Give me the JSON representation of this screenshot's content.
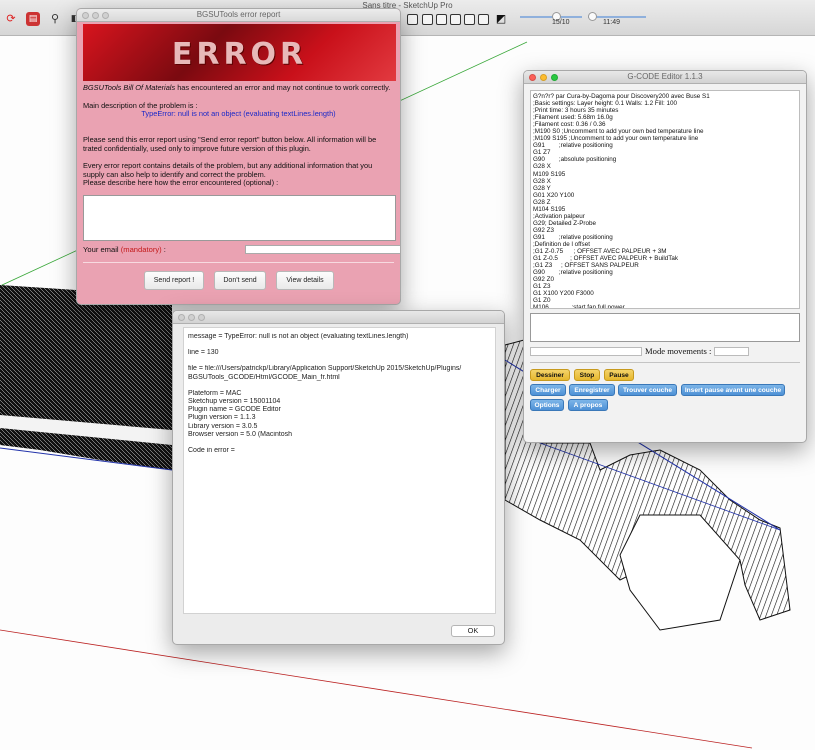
{
  "app": {
    "title": "Sans titre - SketchUp Pro",
    "scene_slider_label": "15/10",
    "time_slider_label": "11:49"
  },
  "toolbar": {
    "icons": [
      "refresh-icon",
      "clipboard-icon",
      "magnifier-icon",
      "plugin-icon",
      "shadow-icon",
      "camera-icon",
      "home-icon",
      "box-icon",
      "box-icon-2",
      "house-icon",
      "lamp-icon"
    ]
  },
  "error_window": {
    "title": "BGSUTools error report",
    "banner_text": "ERROR",
    "plugin_name": "BGSUTools Bill Of Materials",
    "intro_suffix": " has encountered an error and may not continue to work correctly.",
    "main_description_label": "Main description of the problem is :",
    "error_message": "TypeError: null is not an object (evaluating textLines.length)",
    "send_text": "Please send this error report using \"Send error report\" button below. All information will be trated confidentially, used only to improve future version of this plugin.",
    "details_text": "Every error report contains details of the problem, but any additional information that you supply can also help to identify and correct the problem.",
    "describe_label": "Please describe here how the error encountered (optional) :",
    "email_label": "Your email",
    "email_mandatory": "(mandatory)",
    "email_colon": " :",
    "buttons": {
      "send": "Send report !",
      "dont_send": "Don't send",
      "view_details": "View details"
    },
    "colors": {
      "background": "#eaa2b2",
      "error_blue": "#1a28c8",
      "mandatory_red": "#c41a1a"
    }
  },
  "details_window": {
    "message": "message = TypeError: null is not an object (evaluating textLines.length)",
    "line": "line = 130",
    "file_1": "file = file:///Users/patrickp/Library/Application Support/SketchUp 2015/SketchUp/Plugins/",
    "file_2": "BGSUTools_GCODE/Html/GCODE_Main_fr.html",
    "platform": "Plateform = MAC",
    "sketchup_version": "Sketchup version = 15001104",
    "plugin_name": "Plugin name = GCODE Editor",
    "plugin_version": "Plugin version = 1.1.3",
    "library_version": "Library version = 3.0.5",
    "browser_version": "Browser version = 5.0 (Macintosh",
    "code_in_error": "Code in error =",
    "ok_label": "OK"
  },
  "gcode_window": {
    "title": "G-CODE Editor 1.1.3",
    "lines": [
      "G?n?r? par Cura-by-Dagoma pour Discovery200 avec Buse S1",
      ";Basic settings: Layer height: 0.1 Walls: 1.2 Fill: 100",
      ";Print time: 3 hours 35 minutes",
      ";Filament used: 5.68m 16.0g",
      ";Filament cost: 0.36 / 0.36",
      ";M190 S0 ;Uncomment to add your own bed temperature line",
      ";M109 S195 ;Uncomment to add your own temperature line",
      "G91        ;relative positioning",
      "G1 Z7",
      "G90        ;absolute positioning",
      "G28 X",
      "M109 S195",
      "G28 X",
      "G28 Y",
      "G01 X20 Y100",
      "G28 Z",
      "M104 S195",
      ";Activation palpeur",
      "G29; Detailed Z-Probe",
      "G92 Z3",
      "G91        ;relative positioning",
      ";Definition de l offset",
      ";G1 Z-0.75      ; OFFSET AVEC PALPEUR + 3M",
      "G1 Z-0.5       ; OFFSET AVEC PALPEUR + BuildTak",
      ";G1 Z3     ; OFFSET SANS PALPEUR",
      "G90        ;relative positioning",
      "G92 Z0",
      "G1 Z3",
      "G1 X100 Y200 F3000",
      "G1 Z0",
      "M106             ;start fan full power"
    ],
    "mode_label": "Mode movements :",
    "buttons": {
      "draw": "Dessiner",
      "stop": "Stop",
      "pause": "Pause",
      "load": "Charger",
      "save": "Enregistrer",
      "find_layer": "Trouver couche",
      "insert_pause": "Insert pause avant une couche",
      "options": "Options",
      "about": "A propos"
    },
    "colors": {
      "yellow_button": "#f4d36a",
      "blue_button": "#4e91d6"
    }
  }
}
